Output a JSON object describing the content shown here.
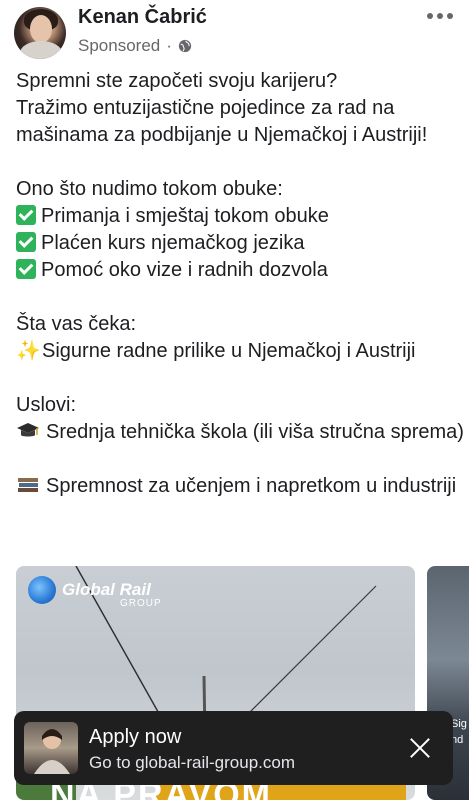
{
  "post": {
    "author": "Kenan Čabrić",
    "sponsored_label": "Sponsored",
    "separator": "·",
    "privacy_icon": "globe-icon",
    "more_icon": "more-horizontal-icon"
  },
  "body": {
    "intro_1": "Spremni ste započeti svoju karijeru?",
    "intro_2": "Tražimo entuzijastične pojedince za rad na",
    "intro_3": "mašinama za podbijanje u Njemačkoj i Austriji!",
    "offer_heading": "Ono što nudimo tokom obuke:",
    "offer_items": [
      "Primanja i smještaj tokom obuke",
      "Plaćen kurs njemačkog jezika",
      "Pomoć oko vize i radnih dozvola"
    ],
    "waits_heading": "Šta vas čeka:",
    "waits_item": "Sigurne radne prilike u Njemačkoj i Austriji",
    "conditions_heading": "Uslovi:",
    "condition_1": "Srednja tehnička škola (ili viša stručna sprema)",
    "condition_2": "Spremnost za učenjem i napretkom u industriji"
  },
  "carousel": {
    "brand_name": "Global Rail",
    "brand_sub": "GROUP",
    "headline_peek": "NA PRAVOM",
    "next_card_text": "Sig nd"
  },
  "cta": {
    "title": "Apply now",
    "subtitle": "Go to global-rail-group.com"
  },
  "colors": {
    "check": "#2eb35a",
    "cta_bg": "#1f1f1f",
    "muted_text": "#65676b"
  }
}
